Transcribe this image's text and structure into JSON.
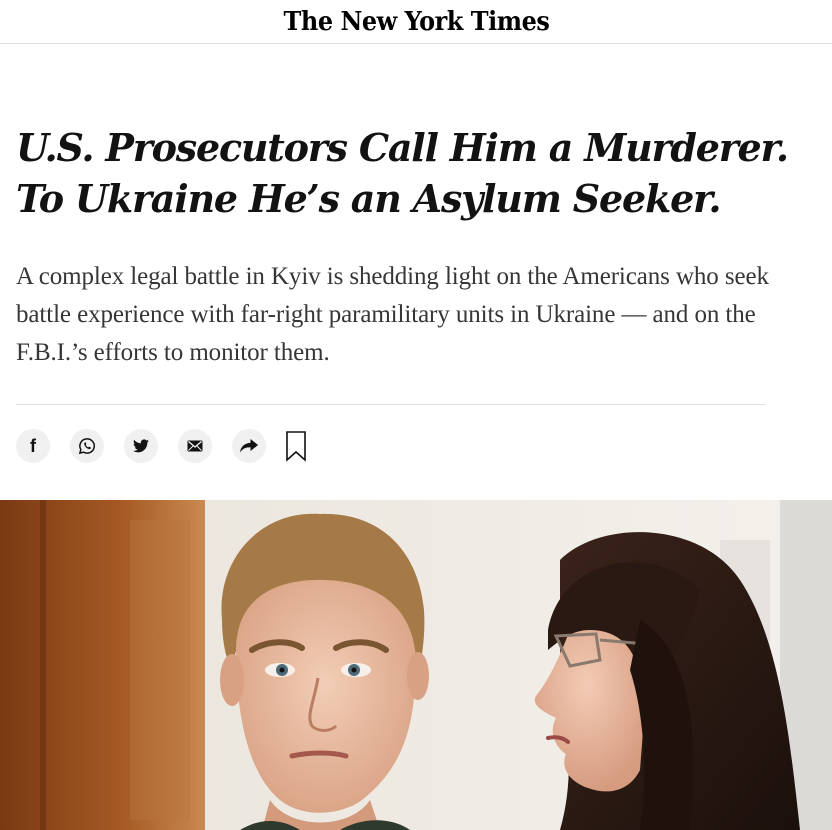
{
  "masthead": {
    "logo_text": "The New York Times"
  },
  "article": {
    "headline": "U.S. Prosecutors Call Him a Murderer. To Ukraine He’s an Asylum Seeker.",
    "summary": "A complex legal battle in Kyiv is shedding light on the Americans who seek battle experience with far-right paramilitary units in Ukraine — and on the F.B.I.’s efforts to monitor them."
  },
  "share_bar": {
    "facebook_glyph": "f",
    "icons": [
      "facebook-icon",
      "whatsapp-icon",
      "twitter-icon",
      "email-icon",
      "share-icon",
      "bookmark-icon"
    ]
  },
  "colors": {
    "headline": "#121212",
    "summary": "#363636",
    "share_button_bg": "#f0f0f0",
    "divider": "#e2e2e2"
  }
}
